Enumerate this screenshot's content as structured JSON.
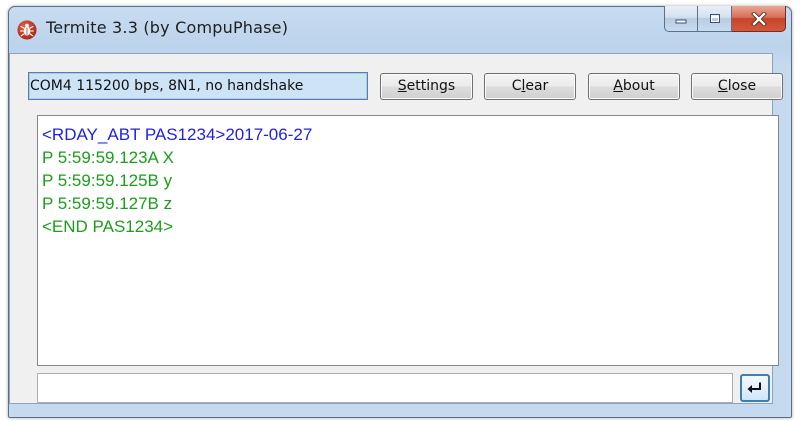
{
  "window": {
    "title": "Termite 3.3 (by CompuPhase)"
  },
  "toolbar": {
    "port_settings": "COM4 115200 bps, 8N1, no handshake",
    "settings_label": "Settings",
    "settings_underline": "S",
    "settings_rest": "ettings",
    "clear_label": "Clear",
    "clear_pre": "C",
    "clear_underline": "l",
    "clear_rest": "ear",
    "about_label": "About",
    "about_underline": "A",
    "about_rest": "bout",
    "close_label": "Close",
    "close_underline": "C",
    "close_rest": "lose"
  },
  "output": {
    "lines": [
      {
        "text": "<RDAY_ABT PAS1234>2017-06-27",
        "color": "#1f1fe6"
      },
      {
        "text": "P 5:59:59.123A X",
        "color": "#1b9e1b"
      },
      {
        "text": "P 5:59:59.125B y",
        "color": "#1b9e1b"
      },
      {
        "text": "P 5:59:59.127B z",
        "color": "#1b9e1b"
      },
      {
        "text": "<END PAS1234>",
        "color": "#1b9e1b"
      }
    ]
  },
  "input": {
    "value": ""
  },
  "icons": {
    "app": "termite-bug-icon",
    "minimize": "minimize-icon",
    "maximize": "maximize-icon",
    "close": "close-icon",
    "enter": "enter-return-icon"
  },
  "colors": {
    "sent_text": "#1f1fe6",
    "received_text": "#1b9e1b",
    "close_button": "#c7442a"
  }
}
